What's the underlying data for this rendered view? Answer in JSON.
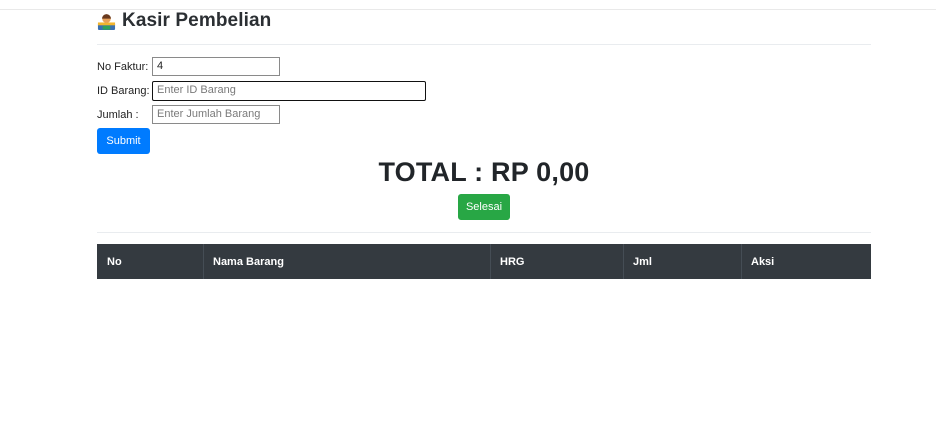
{
  "header": {
    "title": "Kasir Pembelian",
    "logo_icon": "shop-icon"
  },
  "form": {
    "faktur_label": "No Faktur:",
    "faktur_value": "4",
    "barang_label": "ID Barang:",
    "barang_placeholder": "Enter ID Barang",
    "jumlah_label": "Jumlah :",
    "jumlah_placeholder": "Enter Jumlah Barang",
    "submit_label": "Submit"
  },
  "summary": {
    "total_text": "TOTAL : RP 0,00",
    "selesai_label": "Selesai"
  },
  "table": {
    "columns": [
      "No",
      "Nama Barang",
      "HRG",
      "Jml",
      "Aksi"
    ],
    "rows": []
  },
  "colors": {
    "primary": "#007bff",
    "success": "#28a745",
    "table_head": "#343a40"
  }
}
